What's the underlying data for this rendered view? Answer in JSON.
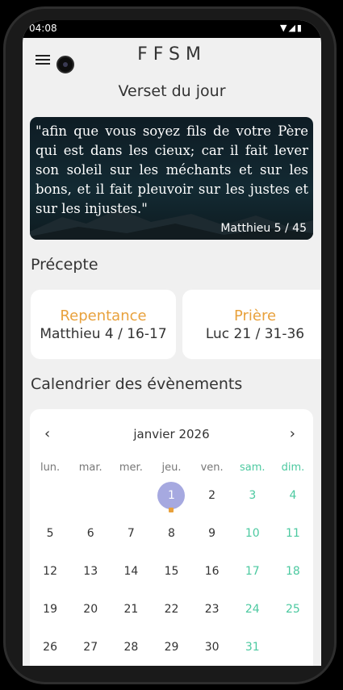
{
  "status_bar": {
    "time": "04:08",
    "icons": "▼◢▮"
  },
  "app": {
    "title": "FFSM"
  },
  "verse_section": {
    "title": "Verset du jour",
    "text": "\"afin que vous soyez fils de votre Père qui est dans les cieux; car il fait lever son soleil sur les méchants et sur les bons, et il fait pleuvoir sur les justes et sur les injustes.\"",
    "reference": "Matthieu 5 / 45"
  },
  "precept_section": {
    "title": "Précepte",
    "cards": [
      {
        "name": "Repentance",
        "reference": "Matthieu 4 / 16-17"
      },
      {
        "name": "Prière",
        "reference": "Luc 21 / 31-36"
      }
    ]
  },
  "calendar": {
    "title": "Calendrier des évènements",
    "month_label": "janvier 2026",
    "prev_icon": "‹",
    "next_icon": "›",
    "weekdays": [
      "lun.",
      "mar.",
      "mer.",
      "jeu.",
      "ven.",
      "sam.",
      "dim."
    ],
    "weeks": [
      [
        "",
        "",
        "",
        "1",
        "2",
        "3",
        "4"
      ],
      [
        "5",
        "6",
        "7",
        "8",
        "9",
        "10",
        "11"
      ],
      [
        "12",
        "13",
        "14",
        "15",
        "16",
        "17",
        "18"
      ],
      [
        "19",
        "20",
        "21",
        "22",
        "23",
        "24",
        "25"
      ],
      [
        "26",
        "27",
        "28",
        "29",
        "30",
        "31",
        ""
      ]
    ],
    "today": "1",
    "event_days": [
      "1"
    ],
    "colors": {
      "weekend": "#4cc9a0",
      "today": "#a6a9e0",
      "event": "#e8a13c"
    }
  }
}
